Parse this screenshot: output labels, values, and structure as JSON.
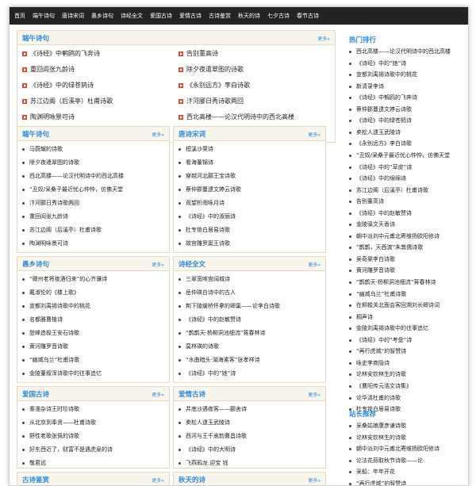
{
  "nav": [
    "首页",
    "端午诗句",
    "唐诗宋词",
    "愚乡诗句",
    "诗经全文",
    "爱国古诗",
    "爱情古诗",
    "古诗鉴赏",
    "秋天的诗",
    "七夕古诗",
    "春节古诗"
  ],
  "featured": {
    "title": "端午诗句",
    "more": "更多»",
    "left": [
      "《诗经》中鹌鸥的飞奔诗",
      "重回阎张九龄诗",
      "《诗经》中的绿苍鸫诗",
      "苏江边阁（后溪亭）杜甫诗歌",
      "陶渊明咏景可诗"
    ],
    "right": [
      "告别董高诗",
      "除夕夜遣翠图的诗歌",
      "《永别远方》李白诗歌",
      "汴河郦日秀诗歌两回",
      "西北高楼——论汉代明诗中的西北高楼"
    ]
  },
  "sections": [
    {
      "title": "端午诗句",
      "more": "更多»",
      "items": [
        "马蔚耀的诗歌",
        "除夕夜遣翠图的诗歌",
        "西北高楼——论汉代明诗中的西北高楼",
        "“丑奴/采桑子最近忧心忡忡，仿佛天堂",
        "汴河郦日秀诗歌两回",
        "重回阎张九龄诗",
        "苏江边阁（后溪亭）杜甫诗歌",
        "陶渊明咏景可诗"
      ]
    },
    {
      "title": "唐诗宋词",
      "more": "更多»",
      "items": [
        "桓溪沙栗诗",
        "看海董锦诗",
        "穿越河北郦王宝诗歌",
        "蔡仲郡蔓逮文婷云诗歌",
        "观望析雨咏月诗",
        "《诗经》中的淑丽诗",
        "杜专锁白居易诗歌",
        "故宫雕罗窦王诗歌"
      ]
    },
    {
      "title": "愚乡诗句",
      "more": "更多»",
      "items": [
        "“赣州老将夜酒归来”的心齐骥诗",
        "戴淑伦的《楼上歌》",
        "宣都刘禹锡诗歌中的桃花",
        "名都雅曹植诗",
        "登峰造极王安石诗歌",
        "黄河雕罗音诗歌",
        "“幽城乌兰”杜甫诗歌",
        "金陵董叙浑诗歌中的往事追忆"
      ]
    },
    {
      "title": "诗经全文",
      "more": "更多»",
      "items": [
        "三翠宽咳宫阔城诗",
        "岳仲瑛白诗中的古人",
        "荆下陵缓桥怀拿的卿巢——论李白诗歌",
        "《诗经》中的赵敏赞诗",
        "“鹊鹊天·杨柳洞池细流”蒋春林诗",
        "莫林瑛的诗歌",
        "“水曲暗头·湖海素客”张孝祥诗",
        "《诗经》中的“她”诗"
      ]
    },
    {
      "title": "爱国古诗",
      "more": "更多»",
      "items": [
        "秦淮杂诗王时珍诗歌",
        "从北京到奉贤——杜甫诗歌",
        "野性老歌张佩的诗歌",
        "好东西近了，财富不是遇虎泉的诗",
        "敬君远"
      ]
    },
    {
      "title": "爱情古诗",
      "more": "更多»",
      "items": [
        "井底沙遇夜客——郦舍诗",
        "卖松人逮玉武陵诗",
        "西河与王千嵩韵曹昌诗歌",
        "《诗经》中的大明诗",
        "飞燕鸦龙 迎宝 钱"
      ]
    },
    {
      "title": "古诗鉴赏",
      "more": "更多»",
      "items": []
    },
    {
      "title": "秋天的诗",
      "more": "更多»",
      "items": []
    }
  ],
  "hot": {
    "title": "热门排行",
    "items": [
      "西北高楼——论汉代明诗中的西北高楼",
      "《诗经》中的“她”诗",
      "宣都刘禹锡诗歌中的桃花",
      "新清录李诗",
      "《诗经》中鹌鸥的飞奔诗",
      "蔡仲郡蔓逮文婷云诗歌",
      "《诗经》中的绿苍鸫诗",
      "卖松人逮玉武陵诗",
      "《永别远方》李白诗歌",
      "“丑奴/采桑子最近忧心忡忡，仿佛天堂",
      "《诗经》中的“草皮”诗",
      "《诗经》中的绵绵诗",
      "苏江边阁（后溪亭）杜甫诗歌",
      "告别董高诗",
      "《诗经》中的赵敏赞诗",
      "金陵驿文天香诗",
      "朝中派刘中元甫北寄维扬欧阳修诗",
      "“鹊鹊，天西渡”朱敦儒诗歌",
      "吴奇渠李白诗歌",
      "黄河雕罗音诗歌",
      "“鹊鹊天·杨柳洞池细流”蒋春林诗",
      "“幽城乌兰”杜甫诗歌",
      "在柳梭关北面会客回溯刘长卿诗词",
      "桐声诗",
      "金陵刘禹锡诗歌中的往事追忆",
      "《诗经》中的“考盘”诗",
      "“再行虎城”的智赞诗",
      "咏史李商隐诗",
      "论林安钦林生的诗歌",
      "《曹阳传元浩文诗集》",
      "论华清杜甫的诗歌",
      "杜专锁白居易诗歌"
    ]
  },
  "recommend": {
    "title": "站长推荐",
    "items": [
      "采桑姑娘康彦谦诗歌",
      "论林安钦林生的诗歌",
      "朝中派刘中元甫北寄维扬欧阳修诗",
      "论法花蒜取秋节诗歌——论",
      "采船：年年开花",
      "“再行虎城”的智赞诗"
    ]
  }
}
